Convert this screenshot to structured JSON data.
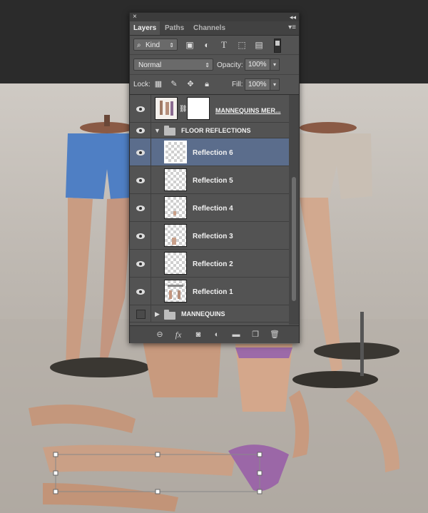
{
  "panel": {
    "close_glyph": "×",
    "collapse_glyph": "◂◂",
    "menu_glyph": "▾≡",
    "tabs": [
      {
        "label": "Layers",
        "active": true
      },
      {
        "label": "Paths",
        "active": false
      },
      {
        "label": "Channels",
        "active": false
      }
    ],
    "filter": {
      "kind_label": "Kind",
      "icons": [
        "image-filter-icon",
        "adjustment-filter-icon",
        "type-filter-icon",
        "shape-filter-icon",
        "smart-object-filter-icon"
      ]
    },
    "blend_mode": "Normal",
    "opacity_label": "Opacity:",
    "opacity_value": "100%",
    "lock_label": "Lock:",
    "fill_label": "Fill:",
    "fill_value": "100%",
    "layers": [
      {
        "name": "MANNEQUINS MER...",
        "type": "layer-with-mask",
        "visible": true,
        "selected": false
      },
      {
        "name": "FLOOR REFLECTIONS",
        "type": "group-open",
        "visible": true,
        "selected": false
      },
      {
        "name": "Reflection 6",
        "type": "layer",
        "visible": true,
        "selected": true
      },
      {
        "name": "Reflection 5",
        "type": "layer",
        "visible": true,
        "selected": false
      },
      {
        "name": "Reflection 4",
        "type": "layer",
        "visible": true,
        "selected": false
      },
      {
        "name": "Reflection 3",
        "type": "layer",
        "visible": true,
        "selected": false
      },
      {
        "name": "Reflection 2",
        "type": "layer",
        "visible": true,
        "selected": false
      },
      {
        "name": "Reflection 1",
        "type": "layer",
        "visible": true,
        "selected": false
      },
      {
        "name": "MANNEQUINS",
        "type": "group-closed",
        "visible": false,
        "selected": false
      }
    ],
    "bottom_icons": [
      "link-layers-icon",
      "fx-icon",
      "add-mask-icon",
      "adjustment-layer-icon",
      "new-group-icon",
      "new-layer-icon",
      "trash-icon"
    ],
    "fx_label": "fx"
  },
  "colors": {
    "panel_bg": "#535353",
    "selected_row": "#5b6d8c",
    "topbar": "#2b2b2b"
  }
}
